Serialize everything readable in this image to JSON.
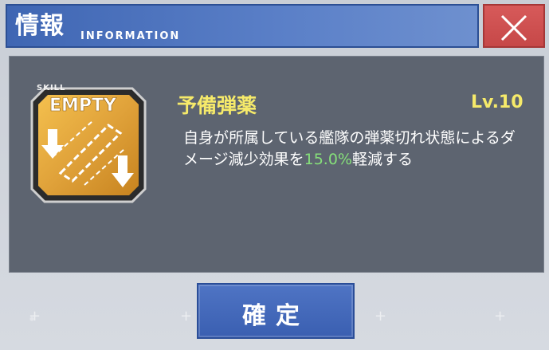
{
  "header": {
    "title": "情報",
    "subtitle": "INFORMATION"
  },
  "close": {
    "icon": "close-icon"
  },
  "skill": {
    "tag": "SKILL",
    "icon_text": "EMPTY",
    "name": "予備弾薬",
    "level": "Lv.10",
    "desc_before": "自身が所属している艦隊の弾薬切れ状態によるダメージ減少効果を",
    "desc_value": "15.0%",
    "desc_after": "軽減する"
  },
  "confirm": {
    "label": "確定"
  },
  "colors": {
    "header_blue": "#4a70bd",
    "close_red": "#cf5050",
    "skill_yellow": "#f6ea6a",
    "highlight_green": "#86e07a",
    "panel_gray": "#5d6470"
  }
}
